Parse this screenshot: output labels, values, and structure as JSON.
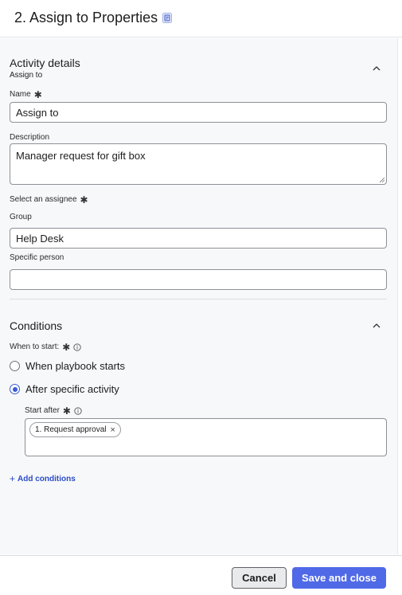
{
  "header": {
    "title": "2. Assign to Properties",
    "title_icon": "document-icon"
  },
  "activity_details": {
    "title": "Activity details",
    "subtitle": "Assign to",
    "collapse_icon": "chevron-up-icon",
    "name": {
      "label": "Name",
      "required": "✱",
      "value": "Assign to"
    },
    "description": {
      "label": "Description",
      "value": "Manager request for gift box"
    },
    "assignee": {
      "label": "Select an assignee",
      "required": "✱"
    },
    "group": {
      "label": "Group",
      "value": "Help Desk"
    },
    "specific_person": {
      "label": "Specific person",
      "value": ""
    }
  },
  "conditions": {
    "title": "Conditions",
    "collapse_icon": "chevron-up-icon",
    "when_to_start": {
      "label": "When to start:",
      "required": "✱",
      "info_icon": "info-icon"
    },
    "options": [
      {
        "label": "When playbook starts",
        "checked": false
      },
      {
        "label": "After specific activity",
        "checked": true
      }
    ],
    "start_after": {
      "label": "Start after",
      "required": "✱",
      "info_icon": "info-icon",
      "tags": [
        {
          "label": "1. Request approval",
          "remove_icon": "close-icon"
        }
      ]
    },
    "add_conditions": {
      "plus": "+",
      "label": "Add conditions"
    }
  },
  "footer": {
    "cancel_label": "Cancel",
    "save_label": "Save and close"
  },
  "colors": {
    "accent": "#5069e6",
    "link": "#2b4cc4",
    "radio_checked": "#3a5bd9"
  }
}
